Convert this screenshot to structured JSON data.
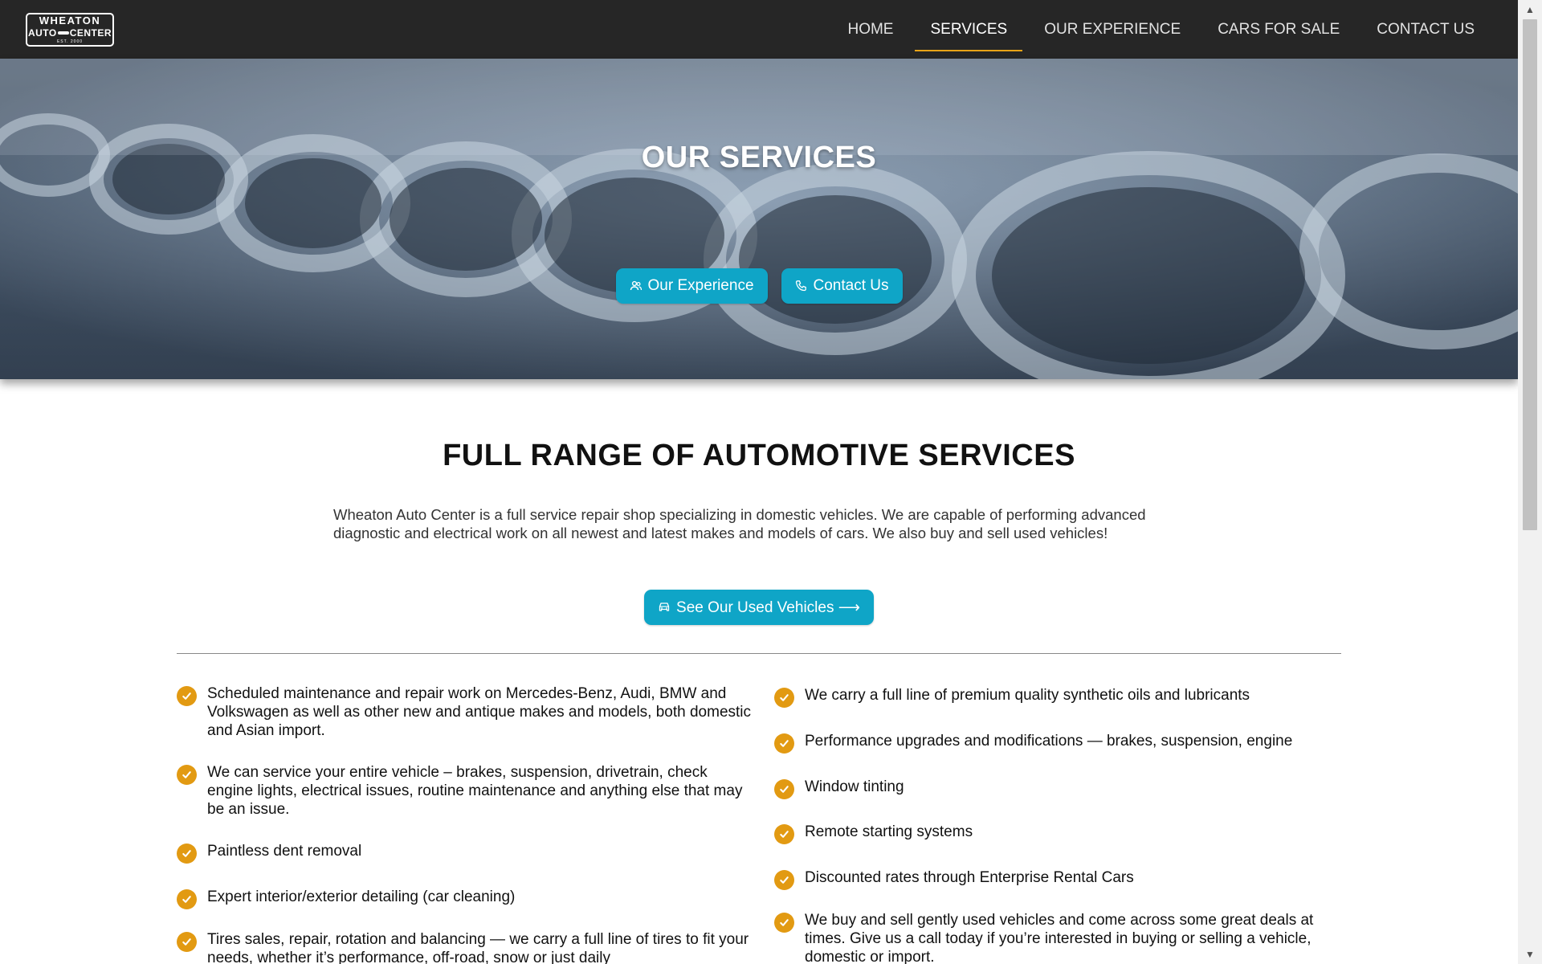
{
  "header": {
    "logo": {
      "line1": "WHEATON",
      "line2a": "AUTO",
      "line2b": "CENTER",
      "line3": "EST. 2000"
    },
    "nav": [
      {
        "label": "HOME",
        "active": false
      },
      {
        "label": "SERVICES",
        "active": true
      },
      {
        "label": "OUR EXPERIENCE",
        "active": false
      },
      {
        "label": "CARS FOR SALE",
        "active": false
      },
      {
        "label": "CONTACT US",
        "active": false
      }
    ],
    "active_underline_color": "#e8a317"
  },
  "hero": {
    "title": "OUR SERVICES",
    "buttons": [
      {
        "label": "Our Experience",
        "icon": "people-icon"
      },
      {
        "label": "Contact Us",
        "icon": "phone-icon"
      }
    ]
  },
  "main": {
    "title": "FULL RANGE OF AUTOMOTIVE SERVICES",
    "intro": "Wheaton Auto Center is a full service repair shop specializing in domestic vehicles. We are capable of performing advanced diagnostic and electrical work on all newest and latest makes and models of cars. We also buy and sell used vehicles!",
    "cta": {
      "label": "See Our Used Vehicles ⟶",
      "icon": "car-icon"
    },
    "services_left": [
      "Scheduled maintenance and repair work on Mercedes-Benz, Audi, BMW and Volkswagen as well as other new and antique makes and models, both domestic and Asian import.",
      "We can service your entire vehicle – brakes, suspension, drivetrain, check engine lights, electrical issues, routine maintenance and anything else that may be an issue.",
      "Paintless dent removal",
      "Expert interior/exterior detailing (car cleaning)",
      "Tires sales, repair, rotation and balancing — we carry a full line of tires to fit your needs, whether it’s performance, off-road, snow or just daily"
    ],
    "services_right": [
      "We carry a full line of premium quality synthetic oils and lubricants",
      "Performance upgrades and modifications — brakes, suspension, engine",
      "Window tinting",
      "Remote starting systems",
      "Discounted rates through Enterprise Rental Cars",
      "We buy and sell gently used vehicles and come across some great deals at times. Give us a call today if you’re interested in buying or selling a vehicle, domestic or import."
    ]
  },
  "colors": {
    "accent_button": "#0fa5c7",
    "check_icon": "#e29a12",
    "header_bg": "#262626"
  }
}
